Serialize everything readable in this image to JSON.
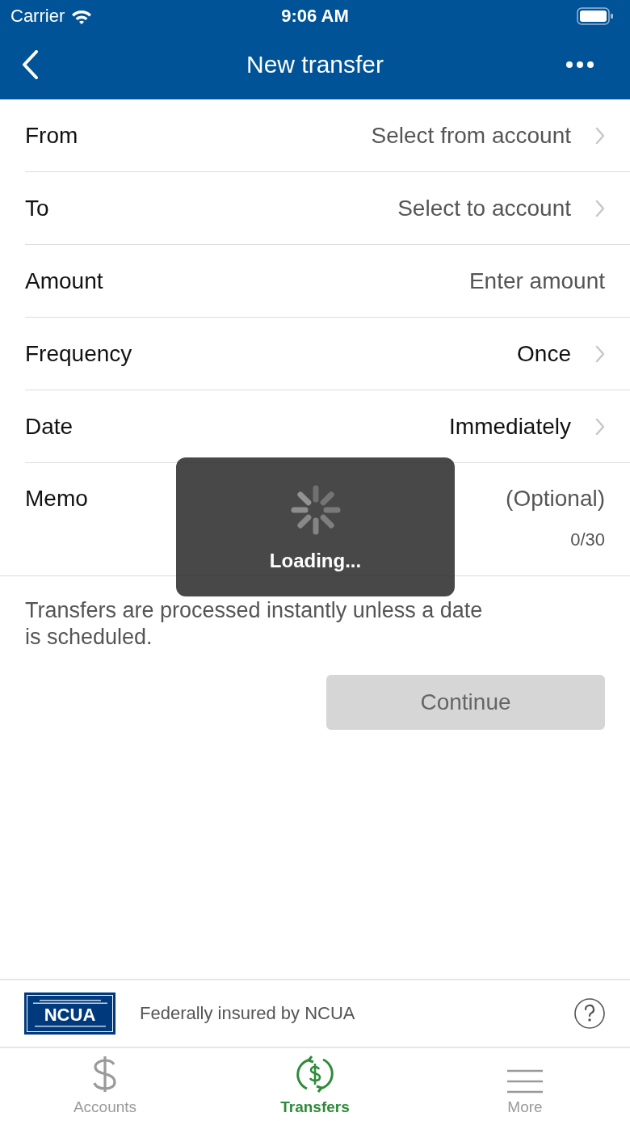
{
  "status_bar": {
    "carrier": "Carrier",
    "time": "9:06 AM"
  },
  "nav_bar": {
    "title": "New transfer"
  },
  "form_rows": [
    {
      "kind": "select",
      "label": "From",
      "value": "Select from account",
      "placeholder": true
    },
    {
      "kind": "select",
      "label": "To",
      "value": "Select to account",
      "placeholder": true
    },
    {
      "kind": "input",
      "label": "Amount",
      "placeholder": "Enter amount"
    },
    {
      "kind": "select",
      "label": "Frequency",
      "value": "Once",
      "placeholder": false
    },
    {
      "kind": "select",
      "label": "Date",
      "value": "Immediately",
      "placeholder": false
    },
    {
      "kind": "memo",
      "label": "Memo",
      "placeholder": "(Optional)",
      "counter": "0/30"
    }
  ],
  "note": "Transfers are processed instantly unless a date is scheduled.",
  "continue_button": {
    "label": "Continue",
    "disabled": true
  },
  "loading": {
    "label": "Loading..."
  },
  "insurance": {
    "logo_text": "NCUA",
    "text": "Federally insured by NCUA"
  },
  "tab_bar": [
    {
      "kind": "dollar",
      "label": "Accounts",
      "selected": false
    },
    {
      "kind": "transfer",
      "label": "Transfers",
      "selected": true
    },
    {
      "kind": "menu",
      "label": "More",
      "selected": false
    }
  ]
}
